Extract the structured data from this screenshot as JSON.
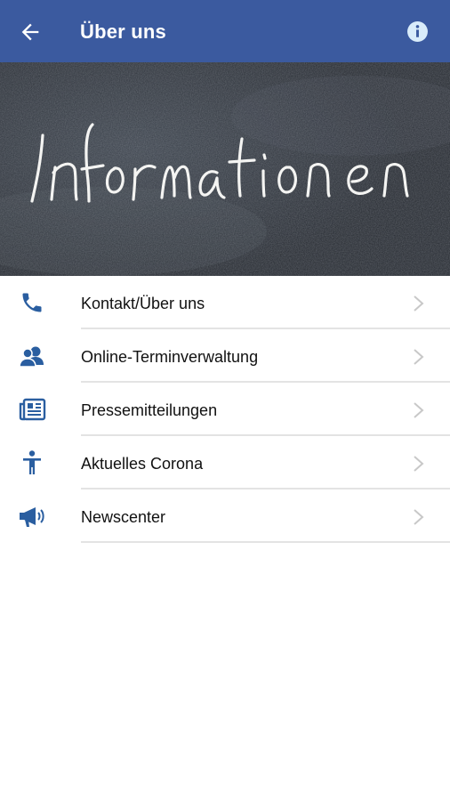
{
  "header": {
    "title": "Über uns",
    "background": "#3b5a9f"
  },
  "banner": {
    "handwritten_text": "Informationen",
    "background": "#2b3038"
  },
  "menu": {
    "items": [
      {
        "label": "Kontakt/Über uns",
        "icon": "phone-icon"
      },
      {
        "label": "Online-Terminverwaltung",
        "icon": "people-icon"
      },
      {
        "label": "Pressemitteilungen",
        "icon": "newspaper-icon"
      },
      {
        "label": "Aktuelles Corona",
        "icon": "person-icon"
      },
      {
        "label": "Newscenter",
        "icon": "megaphone-icon"
      }
    ],
    "icon_color": "#2a5ea0",
    "chevron_color": "#c8c8c8"
  }
}
